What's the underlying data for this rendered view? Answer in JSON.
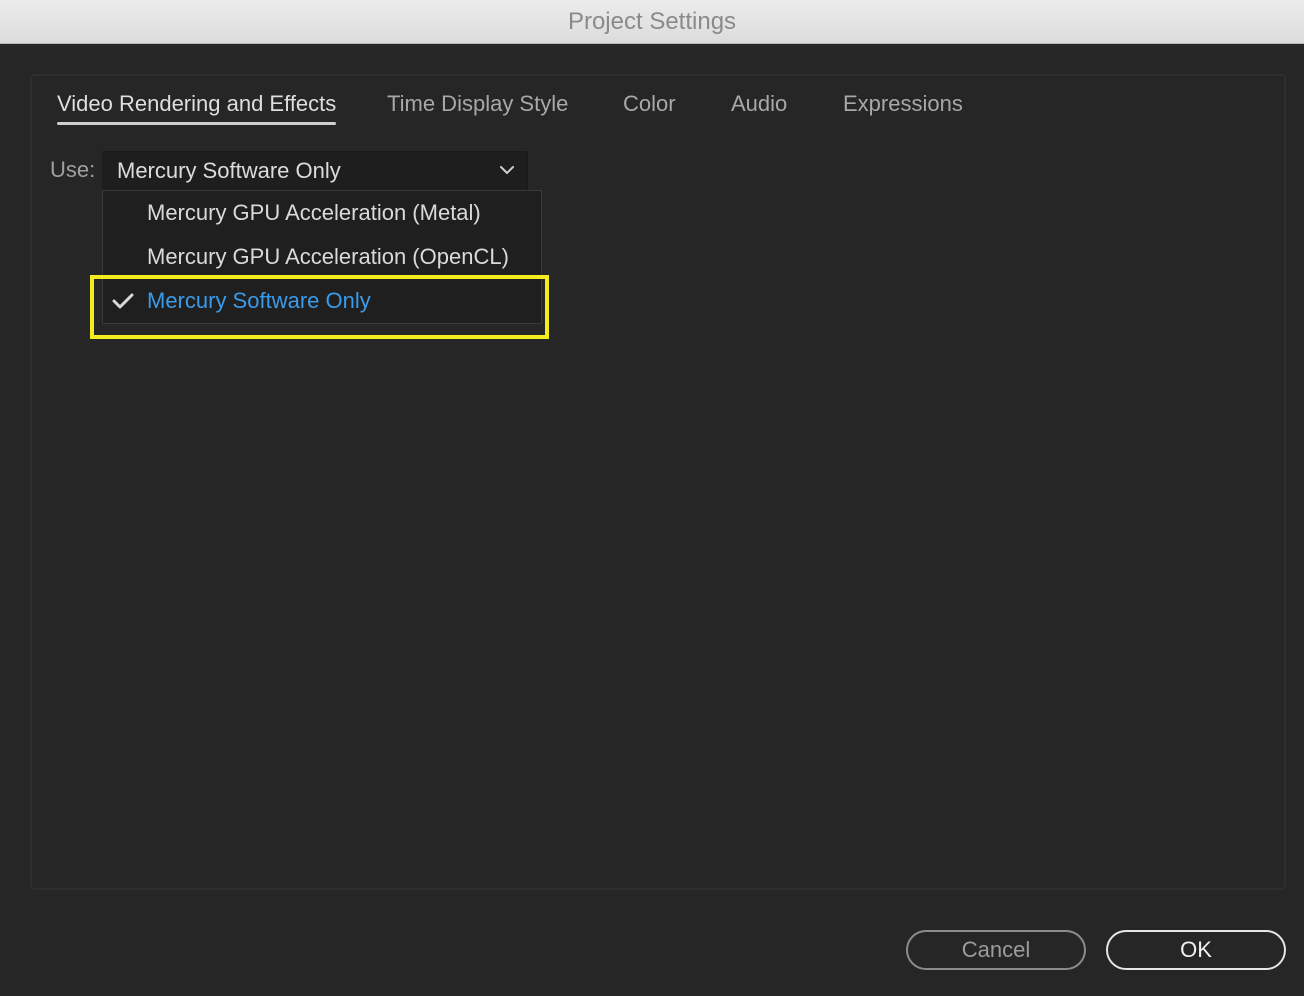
{
  "window": {
    "title": "Project Settings"
  },
  "tabs": [
    {
      "label": "Video Rendering and Effects",
      "active": true
    },
    {
      "label": "Time Display Style",
      "active": false
    },
    {
      "label": "Color",
      "active": false
    },
    {
      "label": "Audio",
      "active": false
    },
    {
      "label": "Expressions",
      "active": false
    }
  ],
  "renderer": {
    "label": "Use:",
    "selected_value": "Mercury Software Only",
    "options": [
      {
        "label": "Mercury GPU Acceleration (Metal)",
        "checked": false
      },
      {
        "label": "Mercury GPU Acceleration (OpenCL)",
        "checked": false
      },
      {
        "label": "Mercury Software Only",
        "checked": true
      }
    ]
  },
  "buttons": {
    "cancel_label": "Cancel",
    "ok_label": "OK"
  },
  "colors": {
    "background": "#262626",
    "accent_selected": "#3a9bea",
    "highlight_box": "#f2ec1e"
  },
  "icons": {
    "dropdown": "chevron-down-icon",
    "checkmark": "checkmark-icon"
  }
}
